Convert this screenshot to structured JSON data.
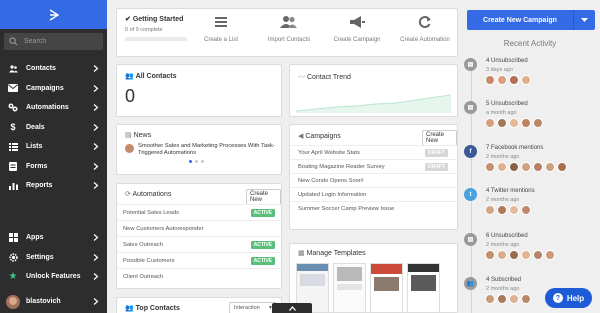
{
  "sidebar": {
    "search_placeholder": "Search",
    "items": [
      {
        "label": "Contacts",
        "icon": "contacts-icon"
      },
      {
        "label": "Campaigns",
        "icon": "campaigns-icon"
      },
      {
        "label": "Automations",
        "icon": "automations-icon"
      },
      {
        "label": "Deals",
        "icon": "dollar-icon"
      },
      {
        "label": "Lists",
        "icon": "lists-icon"
      },
      {
        "label": "Forms",
        "icon": "forms-icon"
      },
      {
        "label": "Reports",
        "icon": "reports-icon"
      }
    ],
    "bottom_items": [
      {
        "label": "Apps",
        "icon": "apps-icon"
      },
      {
        "label": "Settings",
        "icon": "gear-icon"
      },
      {
        "label": "Unlock Features",
        "icon": "star-icon"
      }
    ],
    "username": "blastovich"
  },
  "getting_started": {
    "title": "Getting Started",
    "progress_text": "0 of 9 complete",
    "progress_fraction": 0,
    "actions": [
      {
        "label": "Create a List"
      },
      {
        "label": "Import Contacts"
      },
      {
        "label": "Create Campaign"
      },
      {
        "label": "Create Automation"
      }
    ]
  },
  "all_contacts": {
    "title": "All Contacts",
    "count": "0"
  },
  "contact_trend": {
    "title": "Contact Trend"
  },
  "news": {
    "title": "News",
    "headline": "Smoother Sales and Marketing Processes With Task-Triggered Automations"
  },
  "campaigns": {
    "title": "Campaigns",
    "button": "Create New",
    "items": [
      {
        "name": "Your April Website Stats",
        "badge": "DRAFT"
      },
      {
        "name": "Boating Magazine Reader Survey",
        "badge": "DRAFT"
      },
      {
        "name": "New Condo Opens Soon!",
        "badge": ""
      },
      {
        "name": "Updated Login Information",
        "badge": ""
      },
      {
        "name": "Summer Soccer Camp Preview Issue",
        "badge": ""
      }
    ]
  },
  "automations": {
    "title": "Automations",
    "button": "Create New",
    "items": [
      {
        "name": "Potential Sales Leads",
        "badge": "ACTIVE"
      },
      {
        "name": "New Customers Autoresponder",
        "badge": ""
      },
      {
        "name": "Sales Outreach",
        "badge": "ACTIVE"
      },
      {
        "name": "Possible Customers",
        "badge": "ACTIVE"
      },
      {
        "name": "Client Outreach",
        "badge": ""
      }
    ]
  },
  "manage_templates": {
    "title": "Manage Templates"
  },
  "top_contacts": {
    "title": "Top Contacts",
    "select_value": "Interaction"
  },
  "right": {
    "create_button": "Create New Campaign",
    "recent_activity_title": "Recent Activity",
    "activities": [
      {
        "text": "4 Unsubscribed",
        "time": "3 days ago",
        "icon": "unsubscribe-icon",
        "faces": [
          "#c98a6b",
          "#d9a07e",
          "#b07055",
          "#e0b090"
        ]
      },
      {
        "text": "5 Unsubscribed",
        "time": "a month ago",
        "icon": "unsubscribe-icon",
        "faces": [
          "#d6a080",
          "#a0785a",
          "#e2b898",
          "#c08060",
          "#b88868"
        ]
      },
      {
        "text": "7 Facebook mentions",
        "time": "2 months ago",
        "icon": "facebook-icon",
        "faces": [
          "#c49070",
          "#e0b090",
          "#8a6048",
          "#d0a080",
          "#b58064",
          "#caa080",
          "#a87050"
        ]
      },
      {
        "text": "4 Twitter mentions",
        "time": "2 months ago",
        "icon": "twitter-icon",
        "faces": [
          "#d2a486",
          "#b07856",
          "#e4bc9c",
          "#c08866"
        ]
      },
      {
        "text": "6 Unsubscribed",
        "time": "2 months ago",
        "icon": "unsubscribe-icon",
        "faces": [
          "#c0906c",
          "#dcac8c",
          "#9c6a4e",
          "#e0b494",
          "#b4846a",
          "#d09878"
        ]
      },
      {
        "text": "4 Subscribed",
        "time": "2 months ago",
        "icon": "subscribe-icon",
        "faces": [
          "#c89a7a",
          "#a87858",
          "#dcb090",
          "#b88a6a"
        ]
      }
    ]
  },
  "help_button": "Help",
  "colors": {
    "brand": "#356ae6",
    "sidebar": "#2d2d2d",
    "active": "#5bbf7a",
    "draft": "#d6d6d6",
    "facebook": "#3b5998",
    "twitter": "#4aa3df"
  }
}
